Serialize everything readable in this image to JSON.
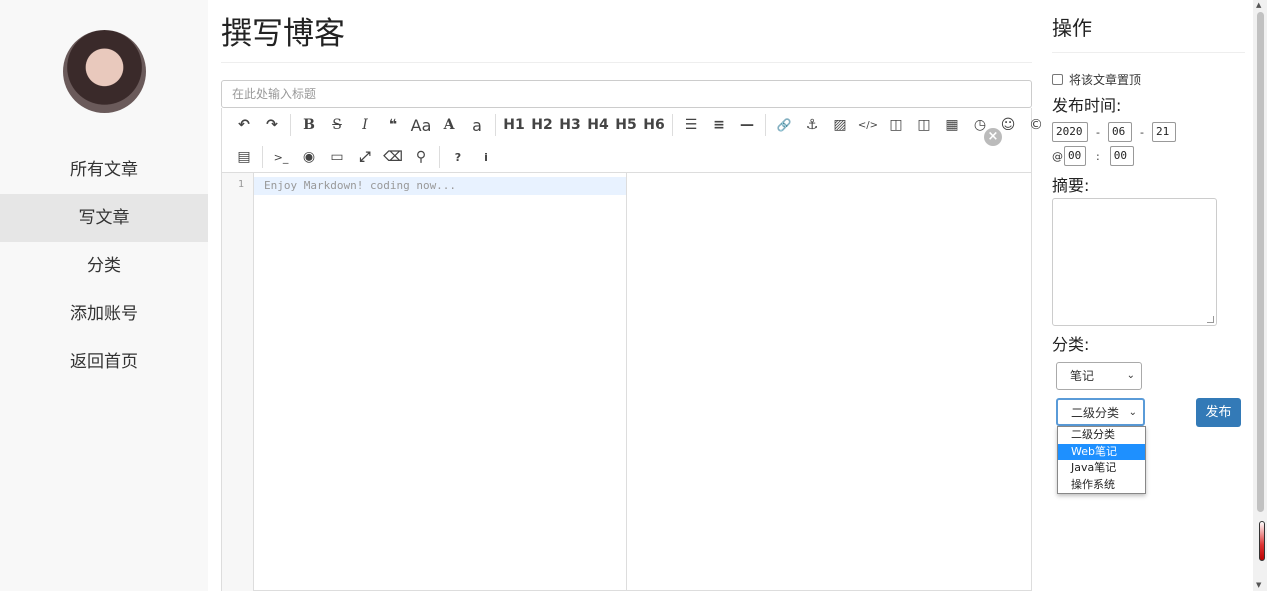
{
  "sidebar": {
    "items": [
      {
        "label": "所有文章"
      },
      {
        "label": "写文章"
      },
      {
        "label": "分类"
      },
      {
        "label": "添加账号"
      },
      {
        "label": "返回首页"
      }
    ]
  },
  "page": {
    "title": "撰写博客",
    "title_placeholder": "在此处输入标题"
  },
  "toolbar": {
    "row1": [
      "↶",
      "↷",
      "B",
      "S",
      "I",
      "❝",
      "Aa",
      "A",
      "a",
      "H1",
      "H2",
      "H3",
      "H4",
      "H5",
      "H6",
      "☰",
      "≡",
      "—",
      "🔗",
      "⚓",
      "▨",
      "</>",
      "◫",
      "◫",
      "▦",
      "◷",
      "☺",
      "©"
    ],
    "row2": [
      "▤",
      ">_",
      "◉",
      "▭",
      "⤢",
      "⌫",
      "⚲",
      "?",
      "i"
    ],
    "close": "×"
  },
  "editor": {
    "line_number": "1",
    "placeholder": "Enjoy Markdown! coding now..."
  },
  "ops": {
    "title": "操作",
    "pin_label": "将该文章置顶",
    "publish_time_label": "发布时间:",
    "year": "2020",
    "month": "06",
    "day": "21",
    "hour": "00",
    "minute": "00",
    "at": "@",
    "date_sep": "-",
    "time_sep": ":",
    "summary_label": "摘要:",
    "category_label": "分类:",
    "category_value": "笔记",
    "subcategory_value": "二级分类",
    "subcategory_options": [
      "二级分类",
      "Web笔记",
      "Java笔记",
      "操作系统"
    ],
    "subcategory_highlighted": "Web笔记",
    "publish_button": "发布"
  },
  "colors": {
    "sidebar_bg": "#f8f8f8",
    "sidebar_active": "#e6e6e6",
    "primary": "#337ab7",
    "highlight": "#1e90ff"
  }
}
